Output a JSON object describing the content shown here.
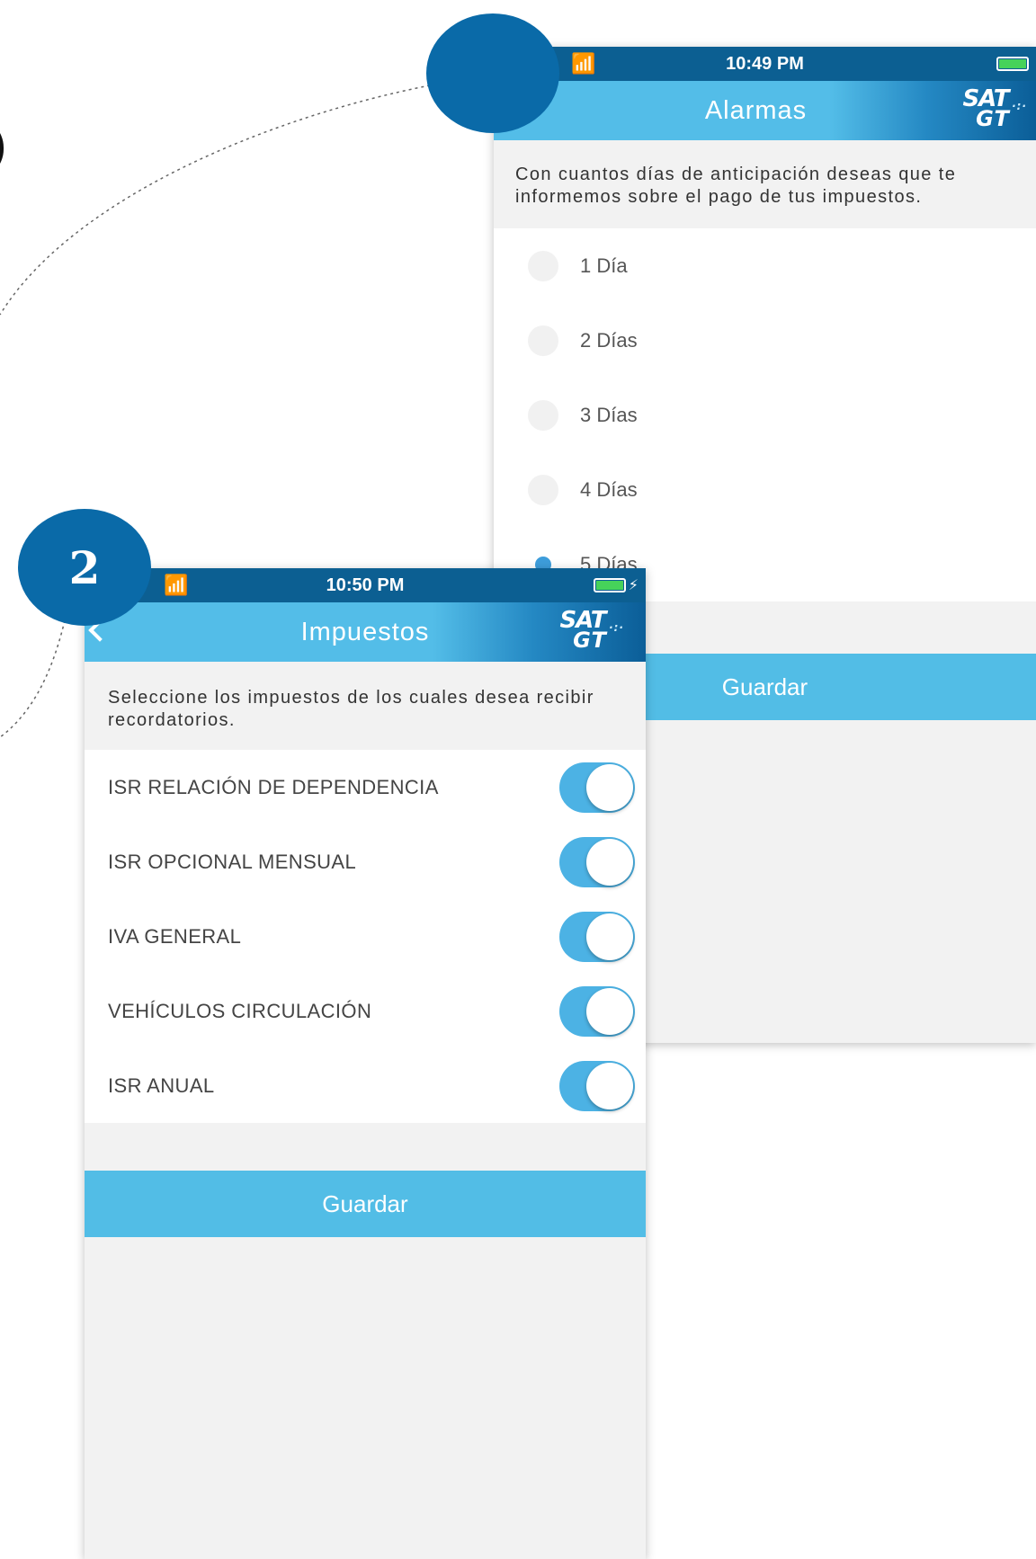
{
  "screen_alarmas": {
    "status": {
      "time": "10:49 PM",
      "wifi_icon": "wifi-icon",
      "battery_icon": "battery-icon"
    },
    "nav": {
      "title": "Alarmas",
      "logo_line1": "SAT",
      "logo_line2": "GT"
    },
    "intro": "Con cuantos días de anticipación deseas que te informemos sobre el pago de tus impuestos.",
    "options": [
      {
        "label": "1 Día",
        "selected": false
      },
      {
        "label": "2 Días",
        "selected": false
      },
      {
        "label": "3 Días",
        "selected": false
      },
      {
        "label": "4 Días",
        "selected": false
      },
      {
        "label": "5 Días",
        "selected": true
      }
    ],
    "save_label": "Guardar"
  },
  "screen_impuestos": {
    "badge_number": "2",
    "status": {
      "time": "10:50 PM",
      "wifi_icon": "wifi-icon",
      "battery_icon": "battery-charging-icon"
    },
    "nav": {
      "title": "Impuestos",
      "logo_line1": "SAT",
      "logo_line2": "GT"
    },
    "intro": "Seleccione los impuestos de los cuales desea recibir recordatorios.",
    "taxes": [
      {
        "label": "ISR RELACIÓN DE DEPENDENCIA",
        "enabled": true
      },
      {
        "label": "ISR OPCIONAL MENSUAL",
        "enabled": true
      },
      {
        "label": "IVA GENERAL",
        "enabled": true
      },
      {
        "label": "VEHÍCULOS CIRCULACIÓN",
        "enabled": true
      },
      {
        "label": "ISR ANUAL",
        "enabled": true
      }
    ],
    "save_label": "Guardar"
  },
  "colors": {
    "badge": "#0a6aa8",
    "status_bar": "#0c5f92",
    "nav_light": "#53bde8",
    "nav_dark": "#0b5e98",
    "toggle_on": "#4cb2e4",
    "button": "#52bde6"
  }
}
